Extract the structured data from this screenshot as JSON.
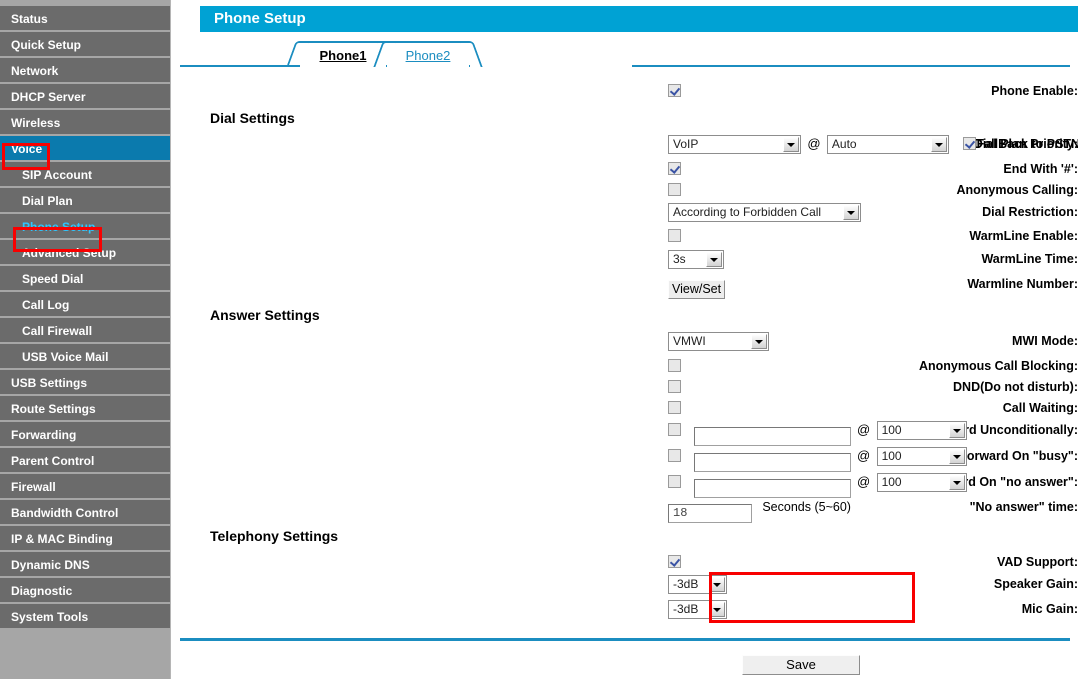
{
  "sidebar": {
    "items": [
      {
        "label": "Status",
        "sub": false,
        "active": false,
        "highlight": false
      },
      {
        "label": "Quick Setup",
        "sub": false,
        "active": false,
        "highlight": false
      },
      {
        "label": "Network",
        "sub": false,
        "active": false,
        "highlight": false
      },
      {
        "label": "DHCP Server",
        "sub": false,
        "active": false,
        "highlight": false
      },
      {
        "label": "Wireless",
        "sub": false,
        "active": false,
        "highlight": false
      },
      {
        "label": "Voice",
        "sub": false,
        "active": true,
        "highlight": false
      },
      {
        "label": "SIP Account",
        "sub": true,
        "active": false,
        "highlight": false
      },
      {
        "label": "Dial Plan",
        "sub": true,
        "active": false,
        "highlight": false
      },
      {
        "label": "Phone Setup",
        "sub": true,
        "active": false,
        "highlight": true
      },
      {
        "label": "Advanced Setup",
        "sub": true,
        "active": false,
        "highlight": false
      },
      {
        "label": "Speed Dial",
        "sub": true,
        "active": false,
        "highlight": false
      },
      {
        "label": "Call Log",
        "sub": true,
        "active": false,
        "highlight": false
      },
      {
        "label": "Call Firewall",
        "sub": true,
        "active": false,
        "highlight": false
      },
      {
        "label": "USB Voice Mail",
        "sub": true,
        "active": false,
        "highlight": false
      },
      {
        "label": "USB Settings",
        "sub": false,
        "active": false,
        "highlight": false
      },
      {
        "label": "Route Settings",
        "sub": false,
        "active": false,
        "highlight": false
      },
      {
        "label": "Forwarding",
        "sub": false,
        "active": false,
        "highlight": false
      },
      {
        "label": "Parent Control",
        "sub": false,
        "active": false,
        "highlight": false
      },
      {
        "label": "Firewall",
        "sub": false,
        "active": false,
        "highlight": false
      },
      {
        "label": "Bandwidth Control",
        "sub": false,
        "active": false,
        "highlight": false
      },
      {
        "label": "IP & MAC Binding",
        "sub": false,
        "active": false,
        "highlight": false
      },
      {
        "label": "Dynamic DNS",
        "sub": false,
        "active": false,
        "highlight": false
      },
      {
        "label": "Diagnostic",
        "sub": false,
        "active": false,
        "highlight": false
      },
      {
        "label": "System Tools",
        "sub": false,
        "active": false,
        "highlight": false
      }
    ]
  },
  "header": {
    "title": "Phone Setup"
  },
  "tabs": [
    {
      "label": "Phone1",
      "active": true
    },
    {
      "label": "Phone2",
      "active": false
    }
  ],
  "form": {
    "phone_enable": {
      "label": "Phone Enable:",
      "checked": true
    },
    "sections": {
      "dial": "Dial Settings",
      "answer": "Answer Settings",
      "telephony": "Telephony Settings"
    },
    "dial_plan_priority": {
      "label": "Dial Plan Priority:",
      "value": "VoIP",
      "at": "@",
      "value2": "Auto",
      "fallback_label": "FallBack to PSTN",
      "fallback_checked": true
    },
    "end_with_hash": {
      "label": "End With '#':",
      "checked": true
    },
    "anonymous_calling": {
      "label": "Anonymous Calling:",
      "checked": false
    },
    "dial_restriction": {
      "label": "Dial Restriction:",
      "value": "According to Forbidden Call"
    },
    "warmline_enable": {
      "label": "WarmLine Enable:",
      "checked": false
    },
    "warmline_time": {
      "label": "WarmLine Time:",
      "value": "3s"
    },
    "warmline_number": {
      "label": "Warmline Number:",
      "button": "View/Set"
    },
    "mwi_mode": {
      "label": "MWI Mode:",
      "value": "VMWI"
    },
    "anonymous_call_blocking": {
      "label": "Anonymous Call Blocking:",
      "checked": false
    },
    "dnd": {
      "label": "DND(Do not disturb):",
      "checked": false
    },
    "call_waiting": {
      "label": "Call Waiting:",
      "checked": false
    },
    "forward_unconditionally": {
      "label": "Forward Unconditionally:",
      "checked": false,
      "number": "",
      "at": "@",
      "port": "100"
    },
    "forward_on_busy": {
      "label": "Forward On \"busy\":",
      "checked": false,
      "number": "",
      "at": "@",
      "port": "100"
    },
    "forward_on_no_answer": {
      "label": "Forward On \"no answer\":",
      "checked": false,
      "number": "",
      "at": "@",
      "port": "100"
    },
    "no_answer_time": {
      "label": "\"No answer\" time:",
      "value": "18",
      "hint": "Seconds (5~60)"
    },
    "vad_support": {
      "label": "VAD Support:",
      "checked": true
    },
    "speaker_gain": {
      "label": "Speaker Gain:",
      "value": "-3dB"
    },
    "mic_gain": {
      "label": "Mic Gain:",
      "value": "-3dB"
    }
  },
  "footer": {
    "save_label": "Save"
  },
  "colors": {
    "header_blue": "#00a2d4",
    "accent_blue": "#1b8dc0",
    "sidebar_item": "#6b6b6b",
    "sidebar_bg": "#a6a6a6",
    "active_item": "#0b7aad",
    "highlight_text": "#2ec6ff",
    "annotation_red": "#f80000"
  }
}
